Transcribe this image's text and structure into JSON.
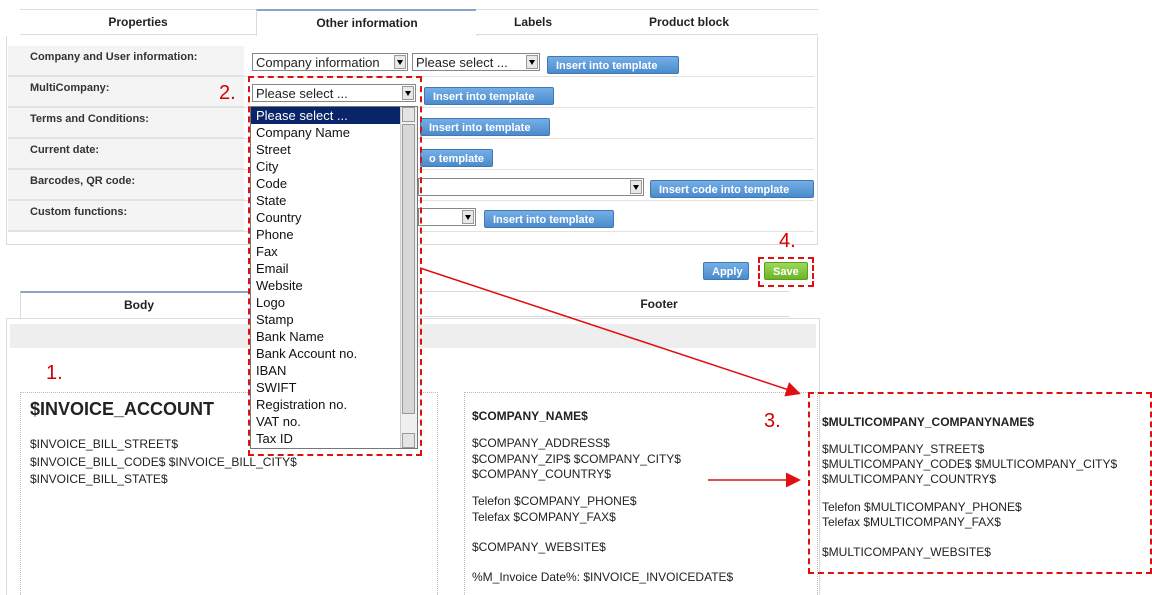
{
  "top_tabs": [
    "Properties",
    "Other information",
    "Labels",
    "Product block"
  ],
  "rows": {
    "company_user": "Company and User information:",
    "multicompany": "MultiCompany:",
    "terms": "Terms and Conditions:",
    "current_date": "Current date:",
    "barcodes": "Barcodes, QR code:",
    "custom_functions": "Custom functions:"
  },
  "selects": {
    "company_info": "Company information",
    "company_field": "Please select ...",
    "multicompany": "Please select ..."
  },
  "buttons": {
    "insert": "Insert into template",
    "insert_partial": "o template",
    "insert_code": "Insert code into template",
    "apply": "Apply",
    "save": "Save"
  },
  "dropdown_options": [
    "Please select ...",
    "Company Name",
    "Street",
    "City",
    "Code",
    "State",
    "Country",
    "Phone",
    "Fax",
    "Email",
    "Website",
    "Logo",
    "Stamp",
    "Bank Name",
    "Bank Account no.",
    "IBAN",
    "SWIFT",
    "Registration no.",
    "VAT no.",
    "Tax ID"
  ],
  "bottom_tabs": {
    "body": "Body",
    "footer": "Footer"
  },
  "callouts": {
    "one": "1.",
    "two": "2.",
    "three": "3.",
    "four": "4."
  },
  "template": {
    "invoice_account": "$INVOICE_ACCOUNT",
    "bill_street": "$INVOICE_BILL_STREET$",
    "bill_code_city": "$INVOICE_BILL_CODE$ $INVOICE_BILL_CITY$",
    "bill_state": "$INVOICE_BILL_STATE$",
    "company_name": "$COMPANY_NAME$",
    "company_address": "$COMPANY_ADDRESS$",
    "company_zip_city": "$COMPANY_ZIP$ $COMPANY_CITY$",
    "company_country": "$COMPANY_COUNTRY$",
    "company_phone": "Telefon $COMPANY_PHONE$",
    "company_fax": "Telefax $COMPANY_FAX$",
    "company_website": "$COMPANY_WEBSITE$",
    "invoice_date": "%M_Invoice Date%: $INVOICE_INVOICEDATE$"
  },
  "multicompany_block": {
    "name": "$MULTICOMPANY_COMPANYNAME$",
    "street": "$MULTICOMPANY_STREET$",
    "code_city": "$MULTICOMPANY_CODE$ $MULTICOMPANY_CITY$",
    "country": "$MULTICOMPANY_COUNTRY$",
    "phone": "Telefon $MULTICOMPANY_PHONE$",
    "fax": "Telefax $MULTICOMPANY_FAX$",
    "website": "$MULTICOMPANY_WEBSITE$"
  },
  "colors": {
    "accent": "#4b8bcc",
    "callout": "#e01010",
    "save": "#6cb424"
  }
}
